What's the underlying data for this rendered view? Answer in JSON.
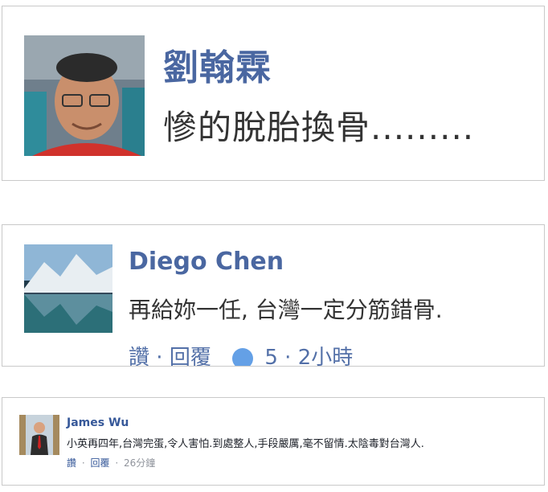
{
  "comments": [
    {
      "name": "劉翰霖",
      "text": "慘的脫胎換骨........."
    },
    {
      "name": "Diego Chen",
      "text": "再給妳一任, 台灣一定分筋錯骨.",
      "meta": {
        "like_label": "讚",
        "reply_label": "回覆",
        "likes": "5",
        "time": "2小時"
      }
    },
    {
      "name": "James Wu",
      "text": "小英再四年,台灣完蛋,令人害怕.到處整人,手段嚴厲,毫不留情.太陰毒對台灣人.",
      "actions": {
        "like_label": "讚",
        "reply_label": "回覆",
        "time": "26分鐘"
      }
    }
  ]
}
